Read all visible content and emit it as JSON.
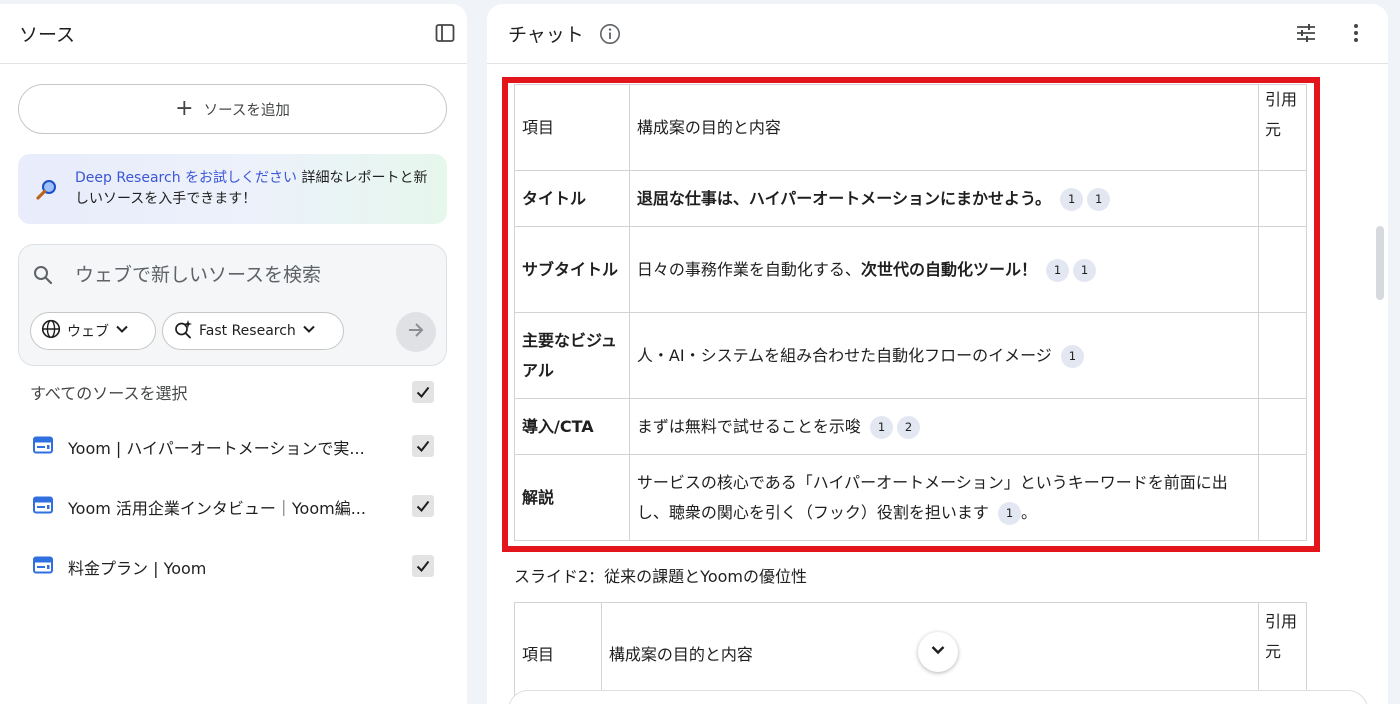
{
  "sources_panel": {
    "title": "ソース",
    "add_button": "ソースを追加",
    "deep_research": {
      "link_text": "Deep Research をお試しください",
      "body_text": " 詳細なレポートと新しいソースを入手できます！"
    },
    "search": {
      "placeholder": "ウェブで新しいソースを検索",
      "web_chip": "ウェブ",
      "mode_chip": "Fast Research"
    },
    "select_all_label": "すべてのソースを選択",
    "items": [
      {
        "label": "Yoom | ハイパーオートメーションで実...",
        "checked": true
      },
      {
        "label": "Yoom 活用企業インタビュー｜Yoom編...",
        "checked": true
      },
      {
        "label": "料金プラン | Yoom",
        "checked": true
      }
    ]
  },
  "chat_panel": {
    "title": "チャット",
    "table1": {
      "headers": [
        "項目",
        "構成案の目的と内容",
        "引用元"
      ],
      "rows": [
        {
          "item": "タイトル",
          "content_bold": "退屈な仕事は、ハイパーオートメーションにまかせよう。",
          "cites": [
            "1",
            "1"
          ]
        },
        {
          "item": "サブタイトル",
          "content": "日々の事務作業を自動化する、",
          "content_bold": "次世代の自動化ツール！",
          "cites": [
            "1",
            "1"
          ]
        },
        {
          "item": "主要なビジュアル",
          "content": "人・AI・システムを組み合わせた自動化フローのイメージ",
          "cites": [
            "1"
          ]
        },
        {
          "item": "導入/CTA",
          "content": "まずは無料で試せることを示唆",
          "cites": [
            "1",
            "2"
          ]
        },
        {
          "item": "解説",
          "content": "サービスの核心である「ハイパーオートメーション」というキーワードを前面に出し、聴衆の関心を引く（フック）役割を担います",
          "cites": [
            "1"
          ],
          "suffix": "。"
        }
      ]
    },
    "slide2_heading": "スライド2：従来の課題とYoomの優位性",
    "table2": {
      "headers": [
        "項目",
        "構成案の目的と内容",
        "引用元"
      ]
    }
  },
  "colors": {
    "highlight_border": "#e3141c",
    "link": "#3b57d6",
    "background": "#f0f4f9"
  }
}
